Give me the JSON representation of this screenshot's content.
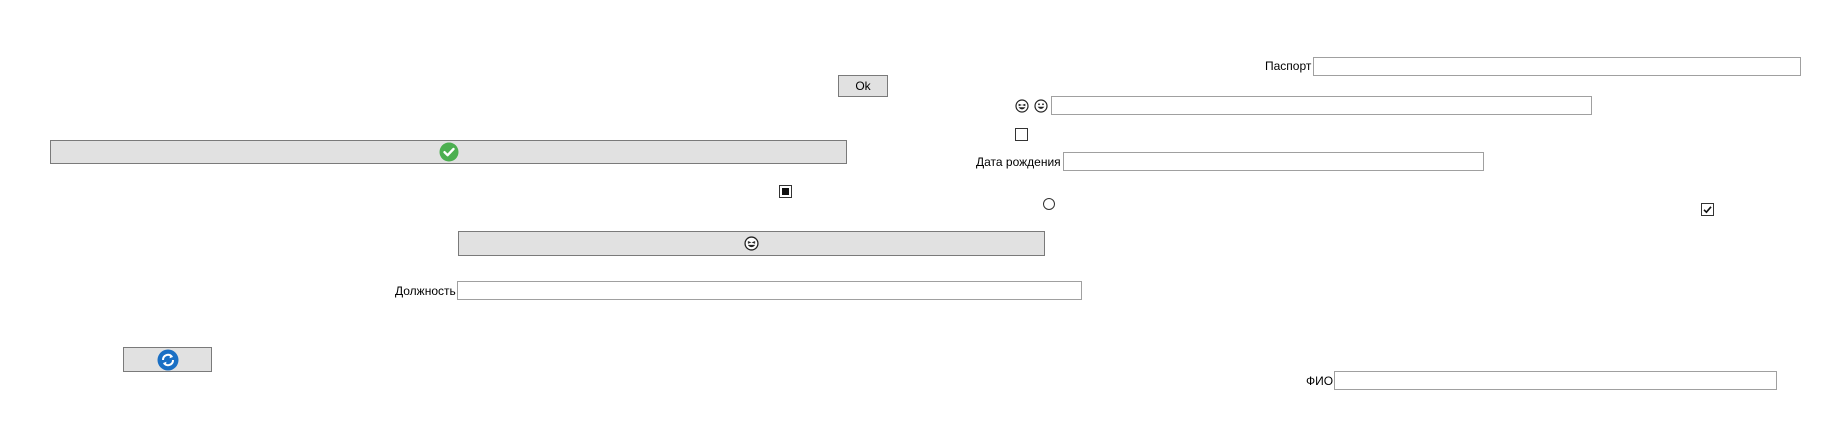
{
  "form": {
    "passport_label": "Паспорт",
    "passport_value": "",
    "birth_date_label": "Дата рождения",
    "birth_date_value": "",
    "position_label": "Должность",
    "position_value": "",
    "fio_label": "ФИО",
    "fio_value": "",
    "emoji_field_value": ""
  },
  "buttons": {
    "ok_label": "Ok"
  },
  "controls": {
    "checkbox_small_center": "unchecked",
    "checkbox_square_left": "indeterminate",
    "checkbox_right": "checked",
    "radio_center": "unselected"
  },
  "icons": {
    "wide_button_icon": "check-circle-icon",
    "emoji_button_icon": "grinning-squint-icon",
    "refresh_button_icon": "refresh-icon",
    "emoji_pair": [
      "grinning-squint-icon",
      "grinning-face-icon"
    ]
  },
  "colors": {
    "button_bg": "#e1e1e1",
    "check_green": "#4caf50",
    "refresh_blue": "#1a6fc4",
    "field_border": "#a0a0a0"
  }
}
